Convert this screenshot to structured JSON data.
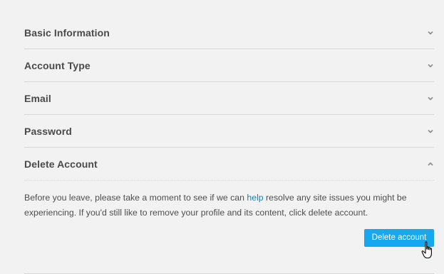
{
  "accordion": {
    "sections": [
      {
        "label": "Basic Information",
        "state": "collapsed"
      },
      {
        "label": "Account Type",
        "state": "collapsed"
      },
      {
        "label": "Email",
        "state": "collapsed"
      },
      {
        "label": "Password",
        "state": "collapsed"
      },
      {
        "label": "Delete Account",
        "state": "expanded"
      }
    ]
  },
  "delete_account": {
    "text_before_link": "Before you leave, please take a moment to see if we can ",
    "link_text": "help",
    "text_after_link": " resolve any site issues you might be experiencing. If you'd still like to remove your profile and its content, click delete account.",
    "button_label": "Delete account"
  },
  "colors": {
    "background": "#f2f2f2",
    "button": "#16a8ef",
    "link": "#1a7fc1",
    "divider": "#d7d7d7"
  },
  "icons": {
    "collapsed": "chevron-down-icon",
    "expanded": "chevron-up-icon",
    "pointer": "hand-pointer-cursor-icon"
  }
}
